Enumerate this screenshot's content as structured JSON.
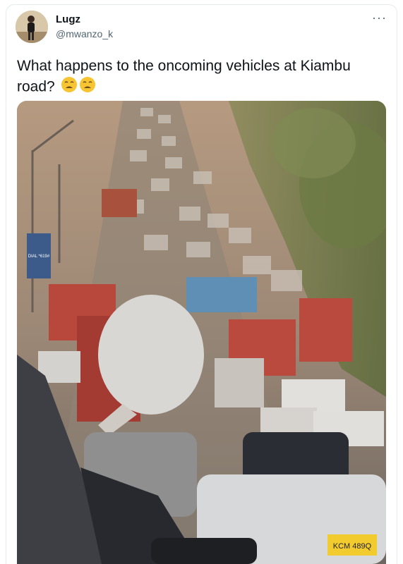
{
  "tweet": {
    "author_name": "Lugz",
    "author_handle": "@mwanzo_k",
    "text_line1": "What happens to the oncoming vehicles at Kiambu",
    "text_line2": "road?",
    "emojis": [
      "weary-face-emoji",
      "weary-face-emoji"
    ],
    "more_icon": "more-icon"
  },
  "photo": {
    "sign_text": "DIAL *619#",
    "truck_plate": "KCM 489Q",
    "description_icon": "traffic-jam-photo"
  },
  "colors": {
    "text": "#0f1419",
    "secondary": "#536471",
    "border": "#e6ecf0"
  }
}
